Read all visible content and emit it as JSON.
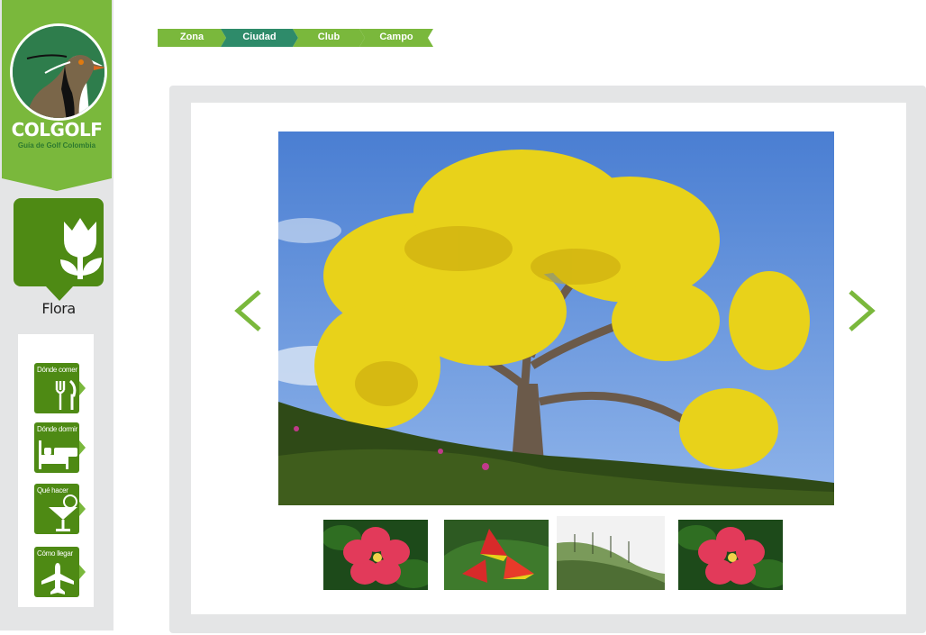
{
  "brand": {
    "name": "COLGOLF",
    "tagline": "Guía de Golf Colombia"
  },
  "section": {
    "label": "Flora",
    "icon": "tulip-icon"
  },
  "menu": [
    {
      "label": "Dónde comer",
      "icon": "fork-knife-icon"
    },
    {
      "label": "Dónde dormir",
      "icon": "bed-icon"
    },
    {
      "label": "Qué hacer",
      "icon": "cocktail-icon"
    },
    {
      "label": "Cómo llegar",
      "icon": "airplane-icon"
    }
  ],
  "breadcrumb": [
    "Zona",
    "Ciudad",
    "Club",
    "Campo"
  ],
  "gallery": {
    "main_image": "yellow-flowering-tree-photo",
    "thumbnails": [
      "red-hibiscus-photo",
      "heliconia-flower-photo",
      "wax-palm-valley-photo",
      "red-hibiscus-photo"
    ],
    "prev_icon": "chevron-left-icon",
    "next_icon": "chevron-right-icon"
  },
  "colors": {
    "brand_green": "#7ab83c",
    "dark_green": "#4e8a14",
    "teal": "#2e8b6a",
    "panel_gray": "#e4e5e6"
  }
}
